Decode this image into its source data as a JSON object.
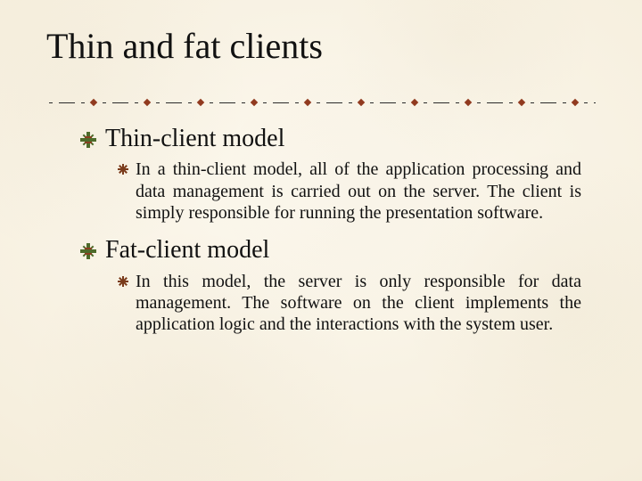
{
  "title": "Thin and fat clients",
  "items": [
    {
      "heading": "Thin-client model",
      "body": "In a thin-client model, all of the application processing and data management is carried out on the server. The client is simply responsible for running the presentation software."
    },
    {
      "heading": "Fat-client model",
      "body": "In this model, the server is only responsible for data management. The software on the client implements the application logic and the interactions with the system user."
    }
  ]
}
